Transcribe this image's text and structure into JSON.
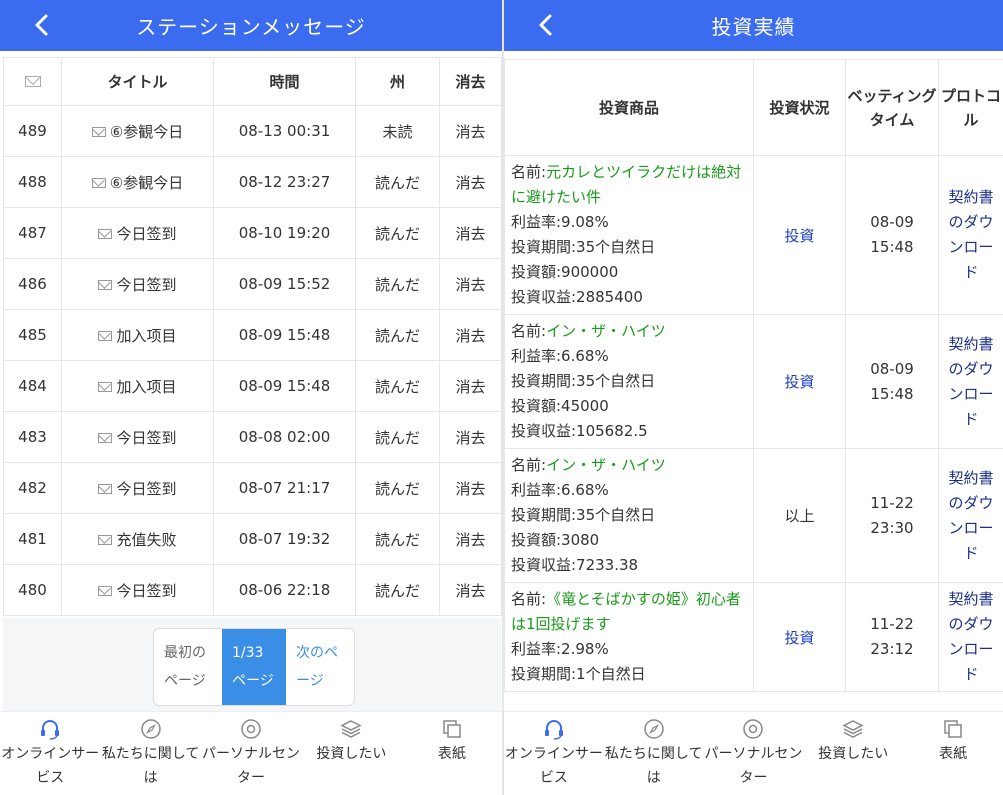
{
  "left": {
    "header": {
      "title": "ステーションメッセージ"
    },
    "table": {
      "headers": {
        "title": "タイトル",
        "time": "時間",
        "state": "州",
        "delete": "消去"
      },
      "rows": [
        {
          "id": "489",
          "title": "⑥参観今日",
          "time": "08-13 00:31",
          "state": "未読",
          "read": false,
          "delete": "消去"
        },
        {
          "id": "488",
          "title": "⑥参観今日",
          "time": "08-12 23:27",
          "state": "読んだ",
          "read": true,
          "delete": "消去"
        },
        {
          "id": "487",
          "title": "今日签到",
          "time": "08-10 19:20",
          "state": "読んだ",
          "read": true,
          "delete": "消去"
        },
        {
          "id": "486",
          "title": "今日签到",
          "time": "08-09 15:52",
          "state": "読んだ",
          "read": true,
          "delete": "消去"
        },
        {
          "id": "485",
          "title": "加入项目",
          "time": "08-09 15:48",
          "state": "読んだ",
          "read": true,
          "delete": "消去"
        },
        {
          "id": "484",
          "title": "加入项目",
          "time": "08-09 15:48",
          "state": "読んだ",
          "read": true,
          "delete": "消去"
        },
        {
          "id": "483",
          "title": "今日签到",
          "time": "08-08 02:00",
          "state": "読んだ",
          "read": true,
          "delete": "消去"
        },
        {
          "id": "482",
          "title": "今日签到",
          "time": "08-07 21:17",
          "state": "読んだ",
          "read": true,
          "delete": "消去"
        },
        {
          "id": "481",
          "title": "充值失败",
          "time": "08-07 19:32",
          "state": "読んだ",
          "read": true,
          "delete": "消去"
        },
        {
          "id": "480",
          "title": "今日签到",
          "time": "08-06 22:18",
          "state": "読んだ",
          "read": true,
          "delete": "消去"
        }
      ]
    },
    "pager": {
      "first": "最初のページ",
      "current": "1/33 ページ",
      "next": "次のページ"
    }
  },
  "right": {
    "header": {
      "title": "投資実績"
    },
    "table": {
      "headers": {
        "product": "投資商品",
        "state": "投資状況",
        "time": "ベッティングタイム",
        "protocol": "プロトコル"
      },
      "rows": [
        {
          "name_label": "名前:",
          "name": "元カレとツイラクだけは絶対に避けたい件",
          "rate": "利益率:9.08%",
          "period": "投資期間:35个自然日",
          "amount": "投資額:900000",
          "profit": "投資収益:2885400",
          "state": "投資",
          "state_link": true,
          "date": "08-09",
          "clock": "15:48",
          "protocol": "契約書のダウンロード"
        },
        {
          "name_label": "名前:",
          "name": "イン・ザ・ハイツ",
          "rate": "利益率:6.68%",
          "period": "投資期間:35个自然日",
          "amount": "投資額:45000",
          "profit": "投資収益:105682.5",
          "state": "投資",
          "state_link": true,
          "date": "08-09",
          "clock": "15:48",
          "protocol": "契約書のダウンロード"
        },
        {
          "name_label": "名前:",
          "name": "イン・ザ・ハイツ",
          "rate": "利益率:6.68%",
          "period": "投資期間:35个自然日",
          "amount": "投資額:3080",
          "profit": "投資収益:7233.38",
          "state": "以上",
          "state_link": false,
          "date": "11-22",
          "clock": "23:30",
          "protocol": "契約書のダウンロード"
        },
        {
          "name_label": "名前:",
          "name": "《竜とそばかすの姫》初心者は1回投げます",
          "rate": "利益率:2.98%",
          "period": "投資期間:1个自然日",
          "amount": "",
          "profit": "",
          "state": "投資",
          "state_link": true,
          "date": "11-22",
          "clock": "23:12",
          "protocol": "契約書のダウンロード"
        }
      ]
    }
  },
  "footer": {
    "items": [
      {
        "label": "オンラインサービス",
        "icon": "headset-icon"
      },
      {
        "label": "私たちに関しては",
        "icon": "compass-icon"
      },
      {
        "label": "パーソナルセンター",
        "icon": "user-center-icon"
      },
      {
        "label": "投資したい",
        "icon": "layers-icon"
      },
      {
        "label": "表紙",
        "icon": "home-icon"
      }
    ]
  },
  "colors": {
    "header": "#3b6cf0",
    "unread": "#e02020",
    "read": "#1b9b1b",
    "link": "#1a3ec2",
    "pager_active": "#3a8ee6"
  }
}
